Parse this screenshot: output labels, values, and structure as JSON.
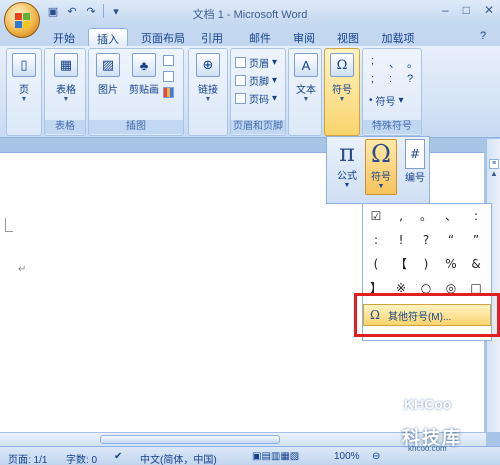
{
  "window": {
    "title": "文档 1 - Microsoft Word",
    "controls": [
      "–",
      "□",
      "✕"
    ]
  },
  "quick_access": [
    "save-icon",
    "undo-icon",
    "redo-icon"
  ],
  "tabs": [
    "开始",
    "插入",
    "页面布局",
    "引用",
    "邮件",
    "审阅",
    "视图",
    "加载项"
  ],
  "active_tab": "插入",
  "ribbon": {
    "groups": {
      "pages": {
        "buttons": [
          "页"
        ]
      },
      "tables": {
        "label": "表格",
        "buttons": [
          "表格"
        ]
      },
      "illustrations": {
        "label": "插图",
        "buttons": [
          "图片",
          "剪贴画"
        ]
      },
      "links": {
        "buttons": [
          "链接"
        ]
      },
      "header_footer": {
        "label": "页眉和页脚",
        "buttons": [
          "页眉",
          "页脚",
          "页码"
        ]
      },
      "text": {
        "buttons": [
          "文本"
        ]
      },
      "symbols": {
        "buttons": [
          "符号"
        ]
      },
      "special_symbols": {
        "label": "特殊符号",
        "chars": [
          ";",
          "、",
          "。",
          ";",
          ":",
          "?",
          "•"
        ],
        "button": "符号"
      }
    }
  },
  "symbol_popup": {
    "buttons": [
      {
        "glyph": "π",
        "label": "公式"
      },
      {
        "glyph": "Ω",
        "label": "符号"
      },
      {
        "glyph": "#",
        "label": "编号"
      }
    ]
  },
  "gallery": {
    "cells": [
      "☑",
      ",",
      "。",
      "、",
      ":",
      ":",
      "!",
      "?",
      "“",
      "”",
      "(",
      "【",
      ")",
      "%",
      "&",
      "】",
      "※",
      "○",
      "◎",
      "□"
    ],
    "more_label": "其他符号(M)..."
  },
  "status": {
    "page": "页面: 1/1",
    "words": "字数: 0",
    "language": "中文(简体，中国)",
    "zoom": "100%"
  },
  "watermark": {
    "logo": "KHCoo",
    "cn": "科技库",
    "url": "khcoo.com"
  }
}
